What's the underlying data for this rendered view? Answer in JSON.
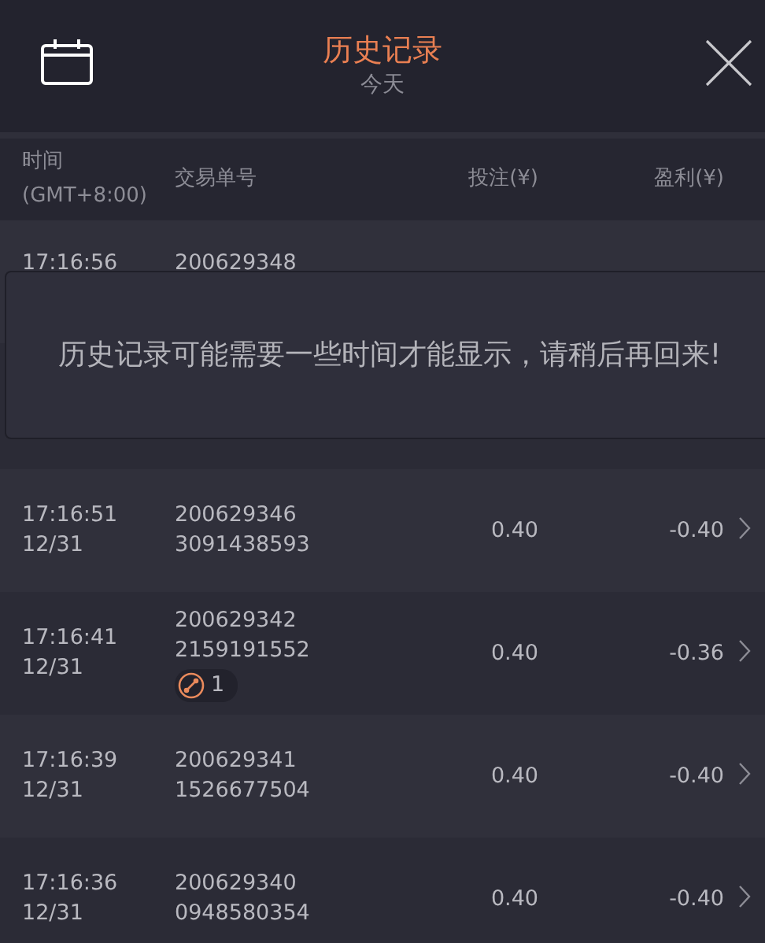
{
  "header": {
    "title": "历史记录",
    "subtitle": "今天"
  },
  "columns": [
    {
      "label": "时间",
      "sublabel": "(GMT+8:00)"
    },
    {
      "label": "交易单号"
    },
    {
      "label": "投注(¥)"
    },
    {
      "label": "盈利(¥)"
    }
  ],
  "rows": [
    {
      "time": "17:16:56",
      "order": [
        "200629348"
      ]
    },
    {
      "time": "17:16:51",
      "date": "12/31",
      "order": [
        "200629346",
        "3091438593"
      ],
      "bet": "0.40",
      "profit": "-0.40"
    },
    {
      "time": "17:16:41",
      "date": "12/31",
      "order": [
        "200629342",
        "2159191552"
      ],
      "badge": "1",
      "bet": "0.40",
      "profit": "-0.36"
    },
    {
      "time": "17:16:39",
      "date": "12/31",
      "order": [
        "200629341",
        "1526677504"
      ],
      "bet": "0.40",
      "profit": "-0.40"
    },
    {
      "time": "17:16:36",
      "date": "12/31",
      "order": [
        "200629340",
        "0948580354"
      ],
      "bet": "0.40",
      "profit": "-0.40"
    }
  ],
  "toast": {
    "message": "历史记录可能需要一些时间才能显示，请稍后再回来!"
  }
}
